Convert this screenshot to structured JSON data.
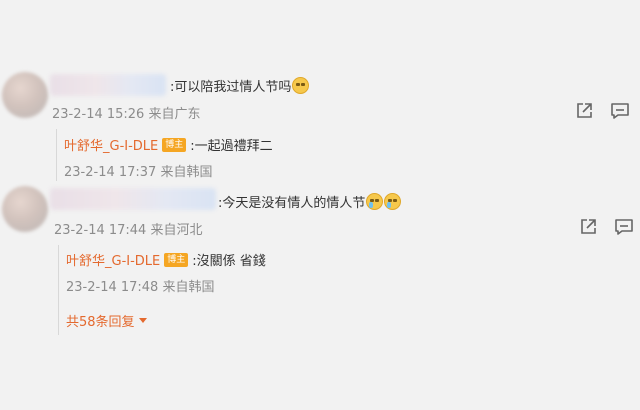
{
  "comments": [
    {
      "text": ":可以陪我过情人节吗",
      "time_source": "23-2-14 15:26 来自广东",
      "reply": {
        "name": "叶舒华_G-I-DLE",
        "badge": "博主",
        "text": ":一起過禮拜二",
        "time_source": "23-2-14 17:37 来自韩国"
      }
    },
    {
      "text": ":今天是没有情人的情人节",
      "time_source": "23-2-14 17:44 来自河北",
      "reply": {
        "name": "叶舒华_G-I-DLE",
        "badge": "博主",
        "text": ":沒關係 省錢",
        "time_source": "23-2-14 17:48 来自韩国"
      },
      "more_replies": "共58条回复"
    }
  ],
  "icons": {
    "share": "share-icon",
    "comment": "comment-icon",
    "emoji_smile": "blush-emoji-icon",
    "emoji_cry": "crying-emoji-icon"
  },
  "colors": {
    "background": "#f2f2f2",
    "accent": "#e4692e",
    "badge": "#f5a623",
    "meta": "#8c8c8c"
  }
}
